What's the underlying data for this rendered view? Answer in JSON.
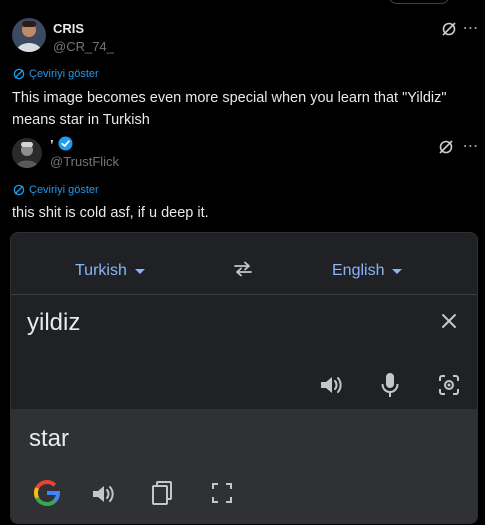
{
  "tweet1": {
    "name": "CRIS",
    "handle": "@CR_74_",
    "translate_label": "Çeviriyi göster",
    "text_line1": "This image becomes even more special when you learn that \"Yildiz\"",
    "text_line2": "means star in Turkish"
  },
  "tweet2": {
    "name": "’",
    "handle": "@TrustFlick",
    "translate_label": "Çeviriyi göster",
    "text": "this shit is cold asf, if u deep it."
  },
  "translator": {
    "source_lang": "Turkish",
    "target_lang": "English",
    "source_text": "yildiz",
    "result_text": "star"
  },
  "colors": {
    "link": "#1d9bf0",
    "gt_accent": "#8ab4f8",
    "verified": "#1d9bf0"
  }
}
